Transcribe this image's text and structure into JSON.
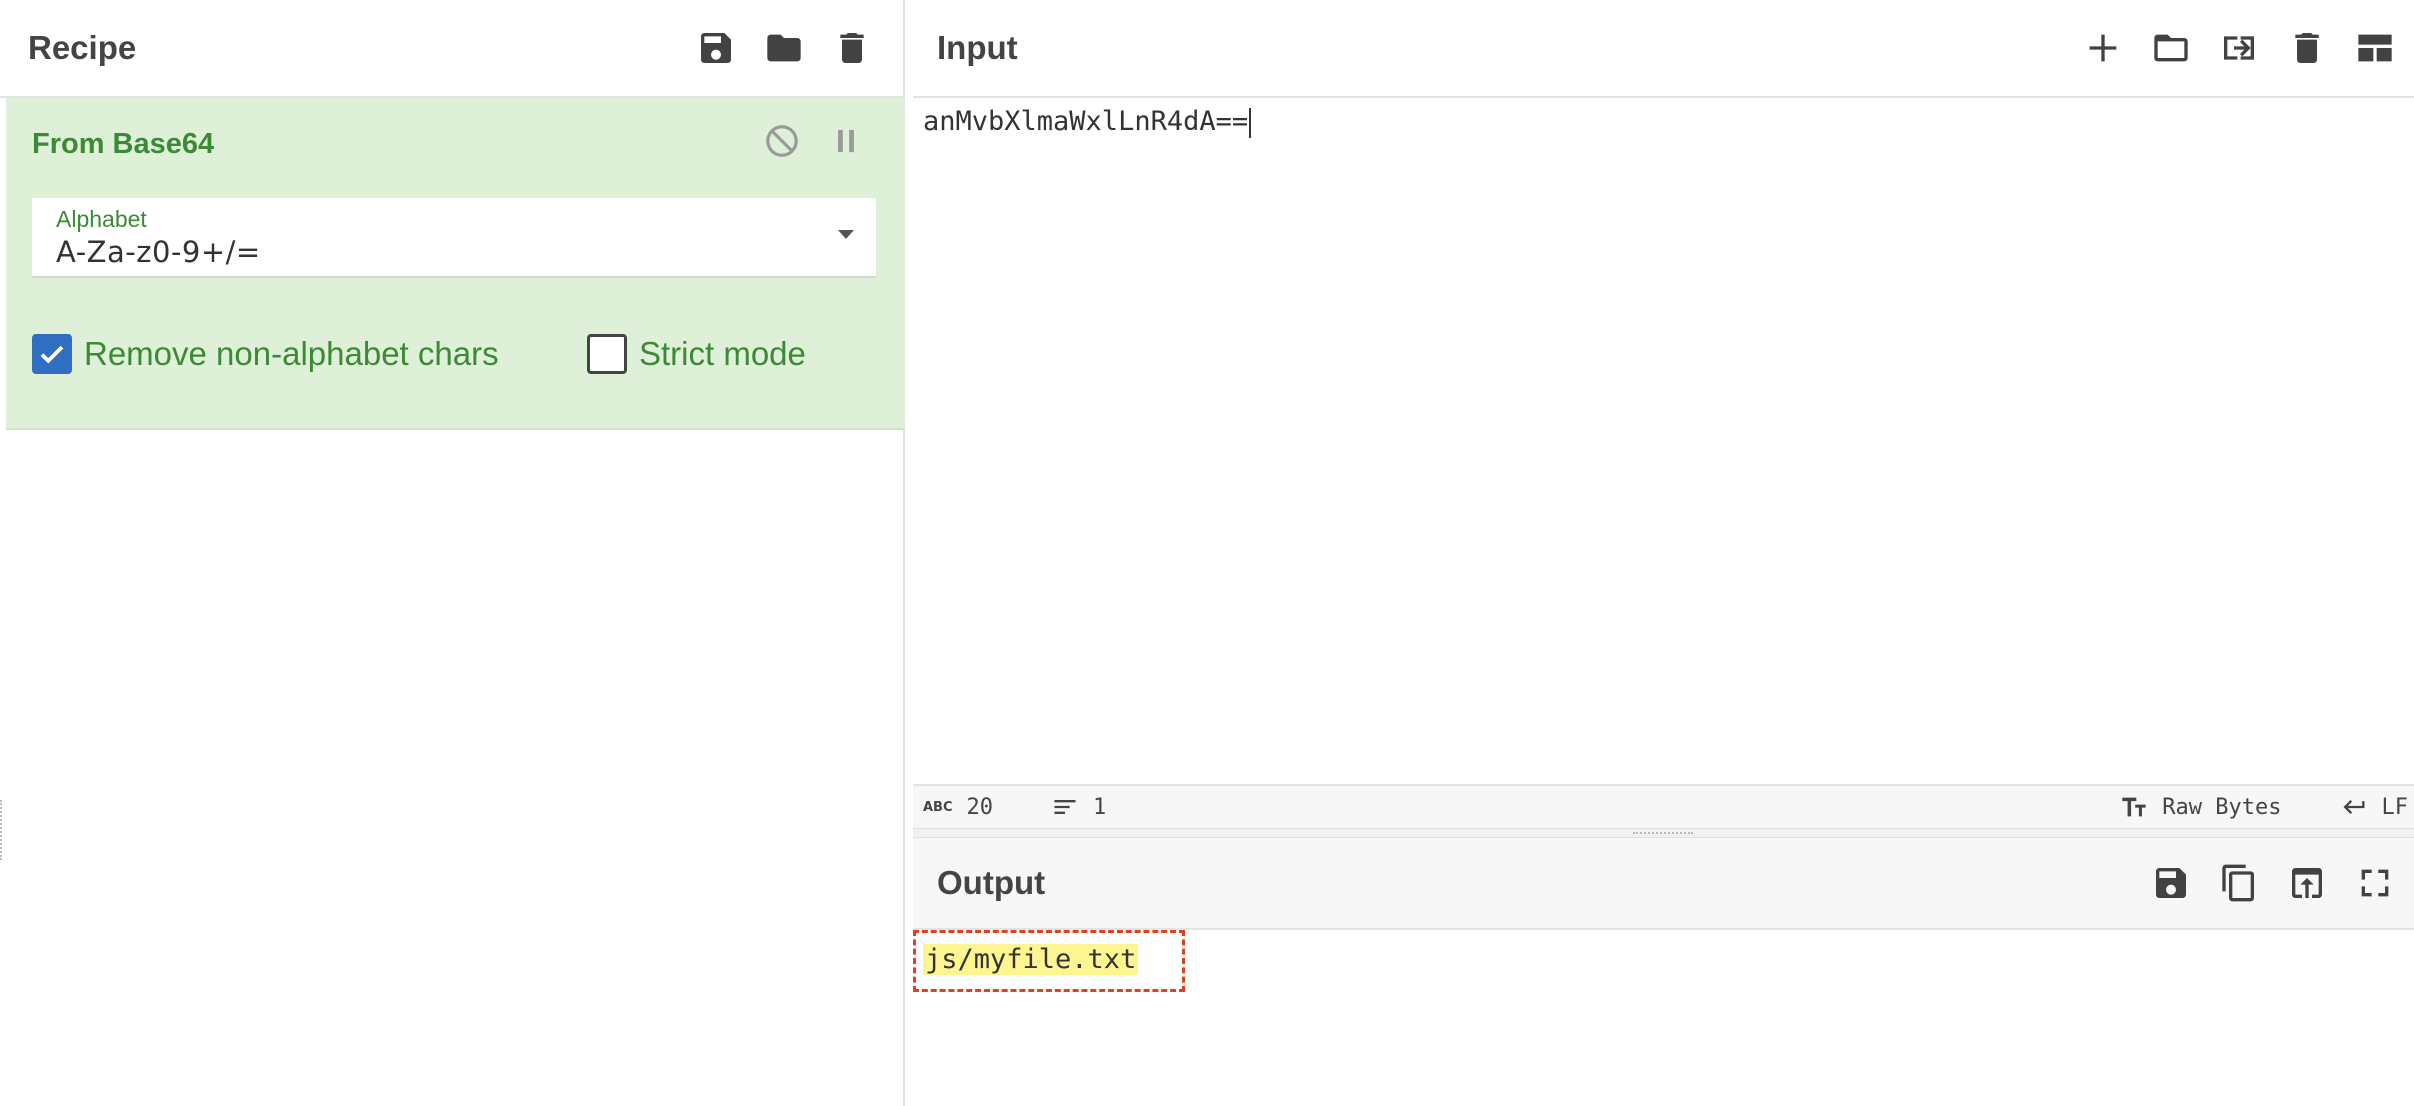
{
  "recipe": {
    "title": "Recipe",
    "icons": [
      "save-icon",
      "folder-icon",
      "trash-icon"
    ],
    "operation": {
      "title": "From Base64",
      "controls": [
        "disable-icon",
        "pause-icon"
      ],
      "alphabet": {
        "label": "Alphabet",
        "value": "A-Za-z0-9+/="
      },
      "remove_non_alphabet": {
        "label": "Remove non-alphabet chars",
        "checked": true
      },
      "strict_mode": {
        "label": "Strict mode",
        "checked": false
      }
    }
  },
  "input": {
    "title": "Input",
    "icons": [
      "plus-icon",
      "folder-icon",
      "import-icon",
      "trash-icon",
      "layout-icon"
    ],
    "text": "anMvbXlmaWxlLnR4dA==",
    "status": {
      "char_count": "20",
      "line_count": "1",
      "encoding": "Raw Bytes",
      "eol": "LF"
    }
  },
  "output": {
    "title": "Output",
    "icons": [
      "save-icon",
      "copy-icon",
      "replace-input-icon",
      "fullscreen-icon"
    ],
    "text": "js/myfile.txt",
    "highlight_color": "#fdf58f",
    "box_color": "#e0401f"
  },
  "colors": {
    "op_background": "#dff0d8",
    "op_text": "#3c8a36",
    "checkbox_checked": "#2f6ec1"
  }
}
